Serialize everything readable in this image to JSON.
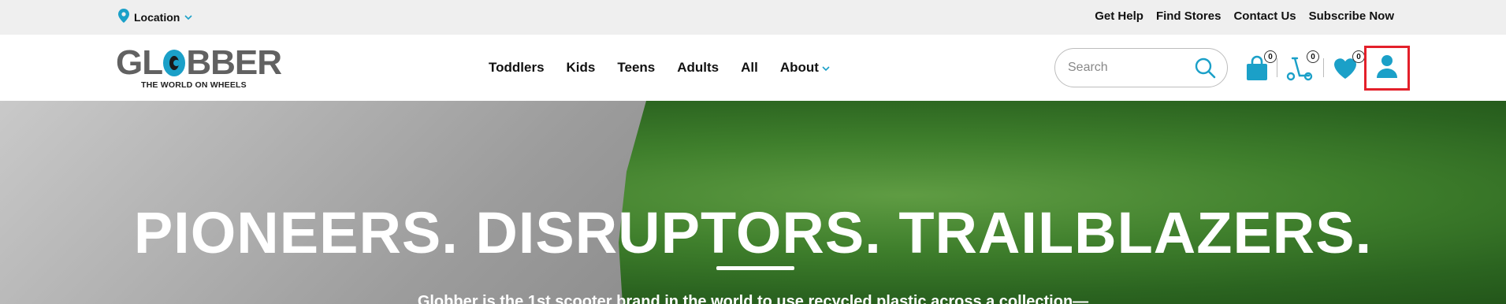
{
  "topbar": {
    "location_label": "Location",
    "links": [
      "Get Help",
      "Find Stores",
      "Contact Us",
      "Subscribe Now"
    ]
  },
  "logo": {
    "word_left": "GL",
    "word_right": "BBER",
    "tagline": "THE WORLD ON WHEELS"
  },
  "nav": {
    "items": [
      "Toddlers",
      "Kids",
      "Teens",
      "Adults",
      "All",
      "About"
    ]
  },
  "search": {
    "placeholder": "Search"
  },
  "header_icons": {
    "bag_count": "0",
    "scooter_count": "0",
    "wishlist_count": "0"
  },
  "hero": {
    "title": "PIONEERS. DISRUPTORS. TRAILBLAZERS.",
    "subtitle": "Globber is the 1st scooter brand in the world to use recycled plastic across a collection—"
  },
  "colors": {
    "accent": "#1ba0c8",
    "highlight_border": "#e3202a",
    "topbar_bg": "#efefef"
  }
}
